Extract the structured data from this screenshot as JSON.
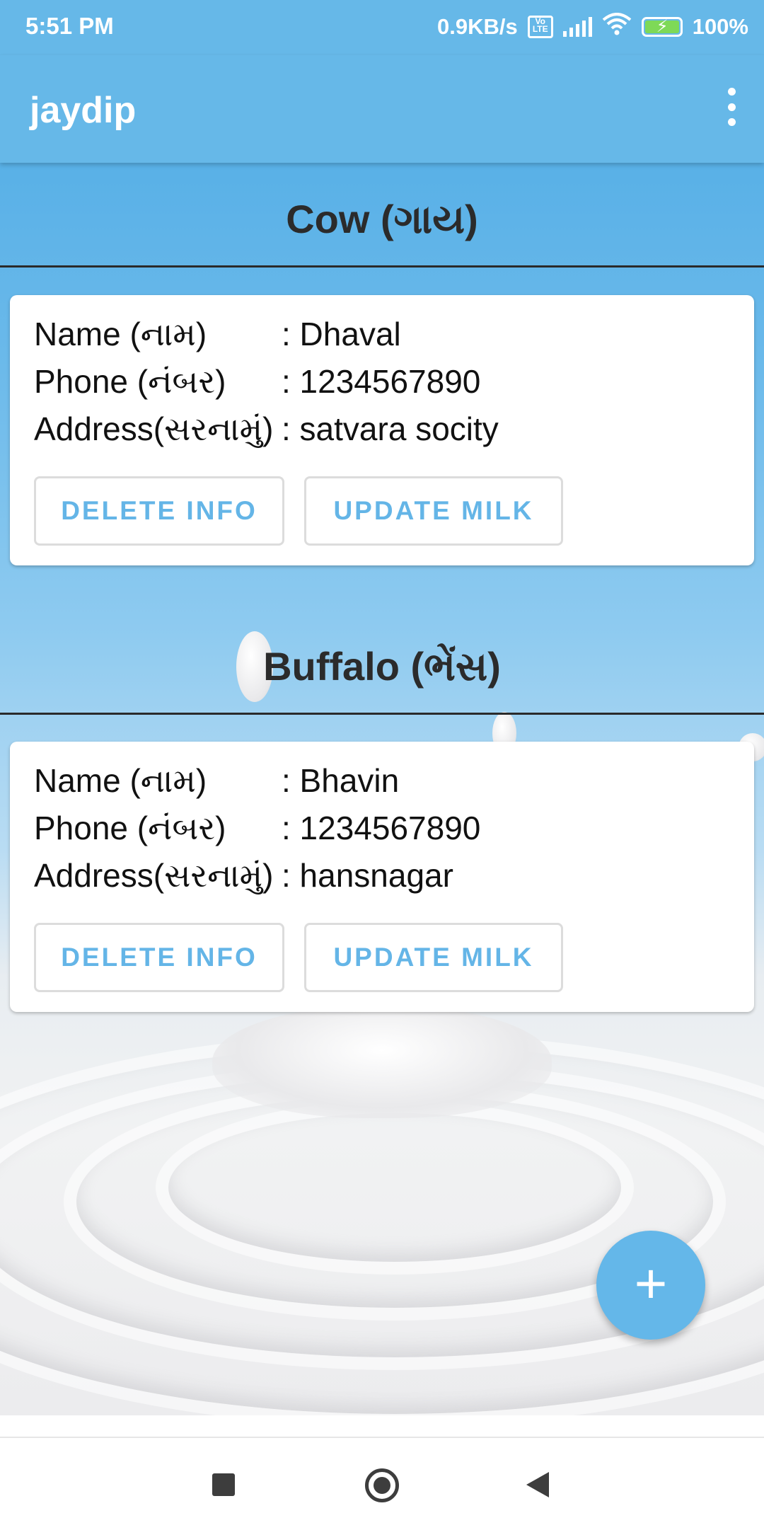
{
  "status_bar": {
    "time": "5:51 PM",
    "net_speed": "0.9KB/s",
    "volte": "Vo LTE",
    "battery": "100%"
  },
  "app_bar": {
    "title": "jaydip",
    "menu_icon": "more-vert-icon"
  },
  "sections": [
    {
      "title": "Cow (ગાય)",
      "card": {
        "rows": [
          {
            "label": "Name (નામ)",
            "value": ": Dhaval"
          },
          {
            "label": "Phone (નંબર)",
            "value": ": 1234567890"
          },
          {
            "label": "Address(સરનામું)",
            "value": ": satvara socity"
          }
        ],
        "delete_label": "DELETE INFO",
        "update_label": "UPDATE MILK"
      }
    },
    {
      "title": "Buffalo (ભેંસ)",
      "card": {
        "rows": [
          {
            "label": "Name (નામ)",
            "value": ": Bhavin"
          },
          {
            "label": "Phone (નંબર)",
            "value": ": 1234567890"
          },
          {
            "label": "Address(સરનામું)",
            "value": ": hansnagar"
          }
        ],
        "delete_label": "DELETE INFO",
        "update_label": "UPDATE MILK"
      }
    }
  ],
  "fab": {
    "label": "+",
    "icon": "add-icon"
  },
  "colors": {
    "accent": "#64b5e7",
    "app_bar": "#66b8e8",
    "text_dark": "#2b2b2b"
  },
  "nav_bar": {
    "recents_icon": "recents-square-icon",
    "home_icon": "home-circle-icon",
    "back_icon": "back-triangle-icon"
  }
}
